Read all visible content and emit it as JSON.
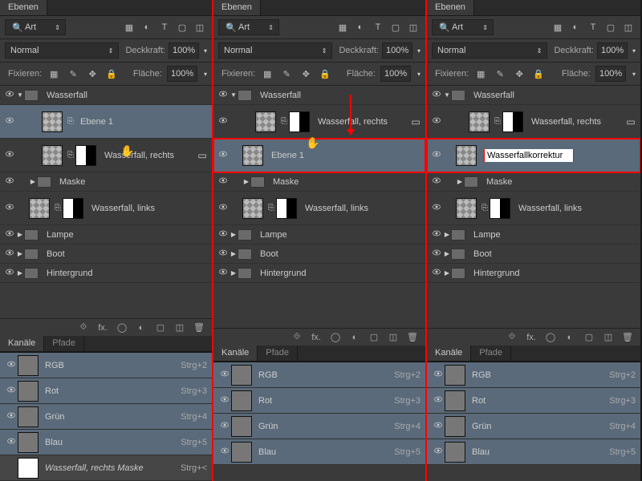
{
  "tabs": {
    "ebenen": "Ebenen",
    "kanale": "Kanäle",
    "pfade": "Pfade"
  },
  "filter": {
    "label": "Art",
    "chev": "⇕"
  },
  "blend": {
    "mode": "Normal",
    "opacity_label": "Deckkraft:",
    "opacity": "100%",
    "fill_label": "Fläche:",
    "fill": "100%",
    "lock_label": "Fixieren:"
  },
  "panels": [
    {
      "layers": [
        {
          "type": "group",
          "name": "Wasserfall",
          "open": true,
          "level": 0
        },
        {
          "type": "layer",
          "name": "Ebene 1",
          "level": 2,
          "selected": true,
          "checker": true,
          "link": true,
          "cursor": true
        },
        {
          "type": "layer",
          "name": "Wasserfall, rechts",
          "level": 2,
          "checker": true,
          "mask": true,
          "link": true,
          "right": "▭"
        },
        {
          "type": "group",
          "name": "Maske",
          "level": 1,
          "open": false
        },
        {
          "type": "layer",
          "name": "Wasserfall, links",
          "level": 1,
          "checker": true,
          "mask": true,
          "link": true
        },
        {
          "type": "group",
          "name": "Lampe",
          "level": 0,
          "open": false
        },
        {
          "type": "group",
          "name": "Boot",
          "level": 0,
          "open": false
        },
        {
          "type": "group",
          "name": "Hintergrund",
          "level": 0,
          "open": false
        }
      ]
    },
    {
      "arrow": true,
      "layers": [
        {
          "type": "group",
          "name": "Wasserfall",
          "open": true,
          "level": 0
        },
        {
          "type": "layer",
          "name": "Wasserfall, rechts",
          "level": 2,
          "checker": true,
          "mask": true,
          "link": true,
          "right": "▭"
        },
        {
          "type": "layer",
          "name": "Ebene 1",
          "level": 1,
          "selected": true,
          "highlight": true,
          "checker": true,
          "cursor": true
        },
        {
          "type": "group",
          "name": "Maske",
          "level": 1,
          "open": false
        },
        {
          "type": "layer",
          "name": "Wasserfall, links",
          "level": 1,
          "checker": true,
          "mask": true,
          "link": true
        },
        {
          "type": "group",
          "name": "Lampe",
          "level": 0,
          "open": false
        },
        {
          "type": "group",
          "name": "Boot",
          "level": 0,
          "open": false
        },
        {
          "type": "group",
          "name": "Hintergrund",
          "level": 0,
          "open": false
        }
      ]
    },
    {
      "layers": [
        {
          "type": "group",
          "name": "Wasserfall",
          "open": true,
          "level": 0
        },
        {
          "type": "layer",
          "name": "Wasserfall, rechts",
          "level": 2,
          "checker": true,
          "mask": true,
          "link": true,
          "right": "▭"
        },
        {
          "type": "layer",
          "name": "Wasserfallkorrektur",
          "level": 1,
          "selected": true,
          "highlight": true,
          "checker": true,
          "rename": true
        },
        {
          "type": "group",
          "name": "Maske",
          "level": 1,
          "open": false
        },
        {
          "type": "layer",
          "name": "Wasserfall, links",
          "level": 1,
          "checker": true,
          "mask": true,
          "link": true
        },
        {
          "type": "group",
          "name": "Lampe",
          "level": 0,
          "open": false
        },
        {
          "type": "group",
          "name": "Boot",
          "level": 0,
          "open": false
        },
        {
          "type": "group",
          "name": "Hintergrund",
          "level": 0,
          "open": false
        }
      ]
    }
  ],
  "channels": [
    {
      "name": "RGB",
      "key": "Strg+2"
    },
    {
      "name": "Rot",
      "key": "Strg+3"
    },
    {
      "name": "Grün",
      "key": "Strg+4"
    },
    {
      "name": "Blau",
      "key": "Strg+5"
    }
  ],
  "mask_channel": {
    "name": "Wasserfall, rechts Maske",
    "key": "Strg+<"
  },
  "cursor_glyph": "✋"
}
